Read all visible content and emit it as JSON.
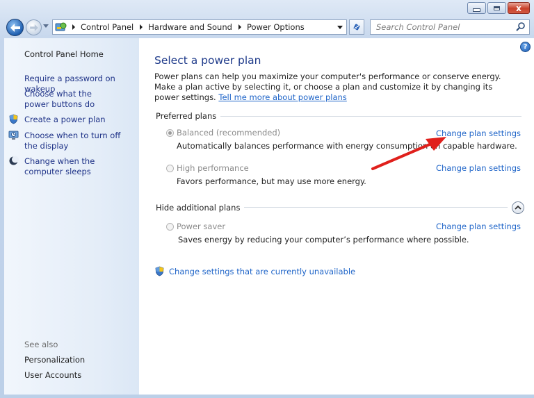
{
  "window": {
    "minimize_icon": "minimize-icon",
    "maximize_icon": "maximize-icon",
    "close_label": "x"
  },
  "address": {
    "breadcrumbs": [
      "Control Panel",
      "Hardware and Sound",
      "Power Options"
    ],
    "search_placeholder": "Search Control Panel"
  },
  "sidebar": {
    "home": "Control Panel Home",
    "tasks": [
      {
        "label": "Require a password on wakeup",
        "icon": "none"
      },
      {
        "label": "Choose what the power buttons do",
        "icon": "none"
      },
      {
        "label": "Create a power plan",
        "icon": "shield-icon"
      },
      {
        "label": "Choose when to turn off the display",
        "icon": "monitor-icon"
      },
      {
        "label": "Change when the computer sleeps",
        "icon": "moon-icon"
      }
    ],
    "see_also_label": "See also",
    "see_also": [
      "Personalization",
      "User Accounts"
    ]
  },
  "main": {
    "help_glyph": "?",
    "title": "Select a power plan",
    "intro_text": "Power plans can help you maximize your computer's performance or conserve energy. Make a plan active by selecting it, or choose a plan and customize it by changing its power settings. ",
    "intro_link": "Tell me more about power plans",
    "preferred_heading": "Preferred plans",
    "hidden_heading": "Hide additional plans",
    "plans": [
      {
        "name": "Balanced (recommended)",
        "desc": "Automatically balances performance with energy consumption on capable hardware.",
        "change": "Change plan settings",
        "selected": true
      },
      {
        "name": "High performance",
        "desc": "Favors performance, but may use more energy.",
        "change": "Change plan settings",
        "selected": false
      },
      {
        "name": "Power saver",
        "desc": "Saves energy by reducing your computer’s performance where possible.",
        "change": "Change plan settings",
        "selected": false
      }
    ],
    "unavailable_link": "Change settings that are currently unavailable"
  },
  "colors": {
    "link": "#1e64c8",
    "sidebar_link": "#1e3287",
    "title": "#1e3a8a",
    "annotation_arrow": "#e0201c"
  }
}
